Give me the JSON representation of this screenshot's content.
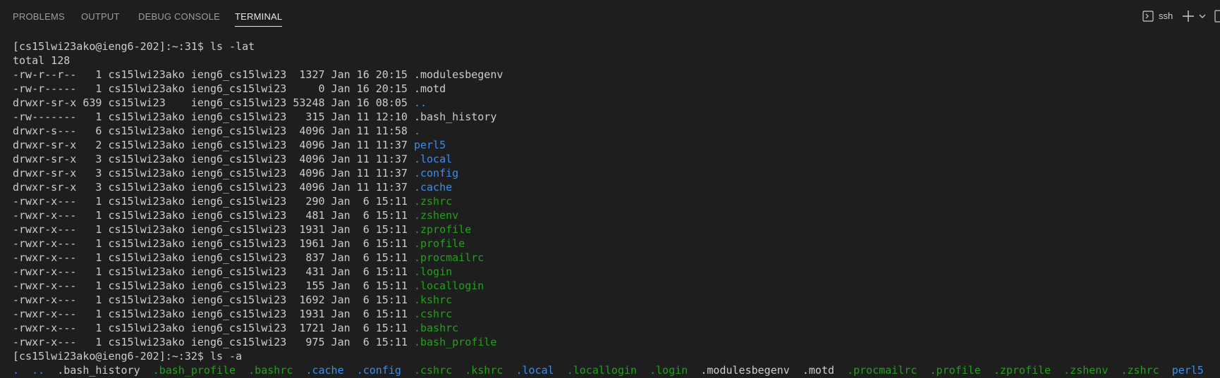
{
  "tabs": [
    {
      "label": "PROBLEMS",
      "active": false
    },
    {
      "label": "OUTPUT",
      "active": false
    },
    {
      "label": "DEBUG CONSOLE",
      "active": false
    },
    {
      "label": "TERMINAL",
      "active": true
    }
  ],
  "toolbar": {
    "terminal_name": "ssh",
    "icons": [
      "terminal-icon",
      "plus-icon",
      "chevron-down-icon",
      "panel-edge-icon"
    ]
  },
  "colors": {
    "background": "#1e1e1e",
    "text": "#cccccc",
    "directory": "#3b8eea",
    "executable": "#23a11a",
    "tab_inactive": "#9d9d9d",
    "tab_active": "#e7e7e7"
  },
  "terminal": {
    "lines": [
      [
        {
          "t": "[cs15lwi23ako@ieng6-202]:~:31$ ls -lat",
          "c": "def"
        }
      ],
      [
        {
          "t": "total 128",
          "c": "def"
        }
      ],
      [
        {
          "t": "-rw-r--r--   1 cs15lwi23ako ieng6_cs15lwi23  1327 Jan 16 20:15 ",
          "c": "def"
        },
        {
          "t": ".modulesbegenv",
          "c": "def"
        }
      ],
      [
        {
          "t": "-rw-r-----   1 cs15lwi23ako ieng6_cs15lwi23     0 Jan 16 20:15 ",
          "c": "def"
        },
        {
          "t": ".motd",
          "c": "def"
        }
      ],
      [
        {
          "t": "drwxr-sr-x 639 cs15lwi23    ieng6_cs15lwi23 53248 Jan 16 08:05 ",
          "c": "def"
        },
        {
          "t": "..",
          "c": "blue"
        }
      ],
      [
        {
          "t": "-rw-------   1 cs15lwi23ako ieng6_cs15lwi23   315 Jan 11 12:10 ",
          "c": "def"
        },
        {
          "t": ".bash_history",
          "c": "def"
        }
      ],
      [
        {
          "t": "drwxr-s---   6 cs15lwi23ako ieng6_cs15lwi23  4096 Jan 11 11:58 ",
          "c": "def"
        },
        {
          "t": ".",
          "c": "blue"
        }
      ],
      [
        {
          "t": "drwxr-sr-x   2 cs15lwi23ako ieng6_cs15lwi23  4096 Jan 11 11:37 ",
          "c": "def"
        },
        {
          "t": "perl5",
          "c": "blue"
        }
      ],
      [
        {
          "t": "drwxr-sr-x   3 cs15lwi23ako ieng6_cs15lwi23  4096 Jan 11 11:37 ",
          "c": "def"
        },
        {
          "t": ".local",
          "c": "blue"
        }
      ],
      [
        {
          "t": "drwxr-sr-x   3 cs15lwi23ako ieng6_cs15lwi23  4096 Jan 11 11:37 ",
          "c": "def"
        },
        {
          "t": ".config",
          "c": "blue"
        }
      ],
      [
        {
          "t": "drwxr-sr-x   3 cs15lwi23ako ieng6_cs15lwi23  4096 Jan 11 11:37 ",
          "c": "def"
        },
        {
          "t": ".cache",
          "c": "blue"
        }
      ],
      [
        {
          "t": "-rwxr-x---   1 cs15lwi23ako ieng6_cs15lwi23   290 Jan  6 15:11 ",
          "c": "def"
        },
        {
          "t": ".zshrc",
          "c": "green"
        }
      ],
      [
        {
          "t": "-rwxr-x---   1 cs15lwi23ako ieng6_cs15lwi23   481 Jan  6 15:11 ",
          "c": "def"
        },
        {
          "t": ".zshenv",
          "c": "green"
        }
      ],
      [
        {
          "t": "-rwxr-x---   1 cs15lwi23ako ieng6_cs15lwi23  1931 Jan  6 15:11 ",
          "c": "def"
        },
        {
          "t": ".zprofile",
          "c": "green"
        }
      ],
      [
        {
          "t": "-rwxr-x---   1 cs15lwi23ako ieng6_cs15lwi23  1961 Jan  6 15:11 ",
          "c": "def"
        },
        {
          "t": ".profile",
          "c": "green"
        }
      ],
      [
        {
          "t": "-rwxr-x---   1 cs15lwi23ako ieng6_cs15lwi23   837 Jan  6 15:11 ",
          "c": "def"
        },
        {
          "t": ".procmailrc",
          "c": "green"
        }
      ],
      [
        {
          "t": "-rwxr-x---   1 cs15lwi23ako ieng6_cs15lwi23   431 Jan  6 15:11 ",
          "c": "def"
        },
        {
          "t": ".login",
          "c": "green"
        }
      ],
      [
        {
          "t": "-rwxr-x---   1 cs15lwi23ako ieng6_cs15lwi23   155 Jan  6 15:11 ",
          "c": "def"
        },
        {
          "t": ".locallogin",
          "c": "green"
        }
      ],
      [
        {
          "t": "-rwxr-x---   1 cs15lwi23ako ieng6_cs15lwi23  1692 Jan  6 15:11 ",
          "c": "def"
        },
        {
          "t": ".kshrc",
          "c": "green"
        }
      ],
      [
        {
          "t": "-rwxr-x---   1 cs15lwi23ako ieng6_cs15lwi23  1931 Jan  6 15:11 ",
          "c": "def"
        },
        {
          "t": ".cshrc",
          "c": "green"
        }
      ],
      [
        {
          "t": "-rwxr-x---   1 cs15lwi23ako ieng6_cs15lwi23  1721 Jan  6 15:11 ",
          "c": "def"
        },
        {
          "t": ".bashrc",
          "c": "green"
        }
      ],
      [
        {
          "t": "-rwxr-x---   1 cs15lwi23ako ieng6_cs15lwi23   975 Jan  6 15:11 ",
          "c": "def"
        },
        {
          "t": ".bash_profile",
          "c": "green"
        }
      ],
      [
        {
          "t": "[cs15lwi23ako@ieng6-202]:~:32$ ls -a",
          "c": "def"
        }
      ],
      [
        {
          "t": ".",
          "c": "blue"
        },
        {
          "t": "  ",
          "c": "def"
        },
        {
          "t": "..",
          "c": "blue"
        },
        {
          "t": "  ",
          "c": "def"
        },
        {
          "t": ".bash_history",
          "c": "def"
        },
        {
          "t": "  ",
          "c": "def"
        },
        {
          "t": ".bash_profile",
          "c": "green"
        },
        {
          "t": "  ",
          "c": "def"
        },
        {
          "t": ".bashrc",
          "c": "green"
        },
        {
          "t": "  ",
          "c": "def"
        },
        {
          "t": ".cache",
          "c": "blue"
        },
        {
          "t": "  ",
          "c": "def"
        },
        {
          "t": ".config",
          "c": "blue"
        },
        {
          "t": "  ",
          "c": "def"
        },
        {
          "t": ".cshrc",
          "c": "green"
        },
        {
          "t": "  ",
          "c": "def"
        },
        {
          "t": ".kshrc",
          "c": "green"
        },
        {
          "t": "  ",
          "c": "def"
        },
        {
          "t": ".local",
          "c": "blue"
        },
        {
          "t": "  ",
          "c": "def"
        },
        {
          "t": ".locallogin",
          "c": "green"
        },
        {
          "t": "  ",
          "c": "def"
        },
        {
          "t": ".login",
          "c": "green"
        },
        {
          "t": "  ",
          "c": "def"
        },
        {
          "t": ".modulesbegenv",
          "c": "def"
        },
        {
          "t": "  ",
          "c": "def"
        },
        {
          "t": ".motd",
          "c": "def"
        },
        {
          "t": "  ",
          "c": "def"
        },
        {
          "t": ".procmailrc",
          "c": "green"
        },
        {
          "t": "  ",
          "c": "def"
        },
        {
          "t": ".profile",
          "c": "green"
        },
        {
          "t": "  ",
          "c": "def"
        },
        {
          "t": ".zprofile",
          "c": "green"
        },
        {
          "t": "  ",
          "c": "def"
        },
        {
          "t": ".zshenv",
          "c": "green"
        },
        {
          "t": "  ",
          "c": "def"
        },
        {
          "t": ".zshrc",
          "c": "green"
        },
        {
          "t": "  ",
          "c": "def"
        },
        {
          "t": "perl5",
          "c": "blue"
        }
      ]
    ]
  }
}
